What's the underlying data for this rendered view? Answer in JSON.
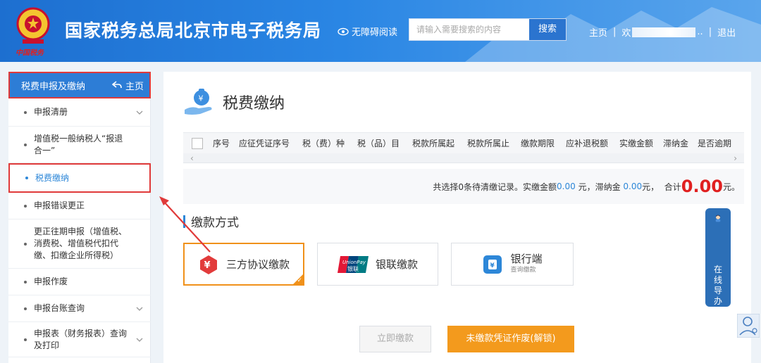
{
  "header": {
    "emblem_text": "中国税务",
    "title": "国家税务总局北京市电子税务局",
    "a11y_label": "无障碍阅读",
    "search_placeholder": "请输入需要搜索的内容",
    "search_button": "搜索",
    "home_link": "主页",
    "welcome_prefix": "欢",
    "welcome_suffix": "..",
    "logout": "退出",
    "sep": "|"
  },
  "sidebar": {
    "header_label": "税费申报及缴纳",
    "home_label": "主页",
    "items": [
      {
        "label": "申报清册",
        "expandable": true
      },
      {
        "label": "增值税一般纳税人“报退合一”",
        "expandable": false
      },
      {
        "label": "税费缴纳",
        "expandable": false,
        "active": true
      },
      {
        "label": "申报错误更正",
        "expandable": false
      },
      {
        "label": "更正往期申报（增值税、消费税、增值税代扣代缴、扣缴企业所得税）",
        "expandable": false
      },
      {
        "label": "申报作废",
        "expandable": false
      },
      {
        "label": "申报台账查询",
        "expandable": true
      },
      {
        "label": "申报表（财务报表）查询及打印",
        "expandable": true
      }
    ]
  },
  "main": {
    "title": "税费缴纳",
    "table_columns": [
      "序号",
      "应征凭证序号",
      "税（费）种",
      "税（品）目",
      "税款所属起",
      "税款所属止",
      "缴款期限",
      "应补退税额",
      "实缴金额",
      "滞纳金",
      "是否逾期"
    ],
    "summary": {
      "prefix": "共选择0条待清缴记录。实缴金额",
      "paid_amount": "0.00",
      "mid1": " 元，滞纳金 ",
      "late_fee": "0.00",
      "mid2": "元，  合计",
      "total": "0.00",
      "suffix": "元。"
    },
    "section_title": "缴款方式",
    "payment_methods": [
      {
        "label": "三方协议缴款",
        "selected": true
      },
      {
        "label": "银联缴款",
        "selected": false,
        "logo_top": "UnionPay",
        "logo_bottom": "银联"
      },
      {
        "label": "银行端",
        "sublabel": "查询缴款",
        "selected": false
      }
    ],
    "pay_button": "立即缴款",
    "void_button": "未缴款凭证作废(解锁)"
  },
  "guide": {
    "chars": [
      "在",
      "线",
      "导",
      "办"
    ]
  },
  "colors": {
    "header_blue": "#1d6fd0",
    "accent_blue": "#2d87d8",
    "orange": "#f39a1d",
    "highlight_red": "#e03a3a",
    "total_red": "#e02020"
  }
}
